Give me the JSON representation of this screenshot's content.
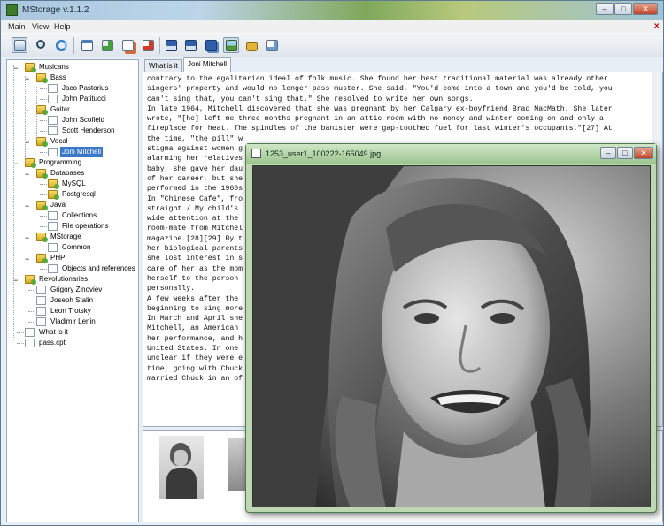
{
  "window": {
    "title": "MStorage v.1.1.2",
    "min": "–",
    "max": "□",
    "close": "✕"
  },
  "menu": {
    "items": [
      "Main",
      "View",
      "Help"
    ],
    "close": "x"
  },
  "toolbar": {
    "icons": [
      "tree-view-icon",
      "search-icon",
      "refresh-icon",
      "window-icon",
      "add-node-icon",
      "copy-icon",
      "delete-icon",
      "save-icon",
      "save-as-icon",
      "save-all-icon",
      "image-icon",
      "lock-icon",
      "find-icon"
    ]
  },
  "tree": [
    {
      "label": "Musicans",
      "level": 0,
      "kind": "folder",
      "exp": "−"
    },
    {
      "label": "Bass",
      "level": 1,
      "kind": "folder",
      "exp": "−"
    },
    {
      "label": "Jaco Pastorius",
      "level": 2,
      "kind": "doc"
    },
    {
      "label": "John Patitucci",
      "level": 2,
      "kind": "doc"
    },
    {
      "label": "Guitar",
      "level": 1,
      "kind": "folder",
      "exp": "−"
    },
    {
      "label": "John Scofield",
      "level": 2,
      "kind": "doc"
    },
    {
      "label": "Scott Henderson",
      "level": 2,
      "kind": "doc"
    },
    {
      "label": "Vocal",
      "level": 1,
      "kind": "folder",
      "exp": "−"
    },
    {
      "label": "Joni Mitchell",
      "level": 2,
      "kind": "doc",
      "selected": true
    },
    {
      "label": "Programming",
      "level": 0,
      "kind": "folder",
      "exp": "−"
    },
    {
      "label": "Databases",
      "level": 1,
      "kind": "folder",
      "exp": "−"
    },
    {
      "label": "MySQL",
      "level": 2,
      "kind": "folder"
    },
    {
      "label": "Postgresql",
      "level": 2,
      "kind": "folder"
    },
    {
      "label": "Java",
      "level": 1,
      "kind": "folder",
      "exp": "−"
    },
    {
      "label": "Collections",
      "level": 2,
      "kind": "doc"
    },
    {
      "label": "File operations",
      "level": 2,
      "kind": "doc"
    },
    {
      "label": "MStorage",
      "level": 1,
      "kind": "folder",
      "exp": "−"
    },
    {
      "label": "Common",
      "level": 2,
      "kind": "doc"
    },
    {
      "label": "PHP",
      "level": 1,
      "kind": "folder",
      "exp": "−"
    },
    {
      "label": "Objects and references",
      "level": 2,
      "kind": "doc"
    },
    {
      "label": "Revolutionaries",
      "level": 0,
      "kind": "folder",
      "exp": "−"
    },
    {
      "label": "Grigory Zinoviev",
      "level": 1,
      "kind": "doc"
    },
    {
      "label": "Joseph Stalin",
      "level": 1,
      "kind": "doc"
    },
    {
      "label": "Leon Trotsky",
      "level": 1,
      "kind": "doc"
    },
    {
      "label": "Vladimir Lenin",
      "level": 1,
      "kind": "doc"
    },
    {
      "label": "What is it",
      "level": 0,
      "kind": "doc"
    },
    {
      "label": "pass.cpt",
      "level": 0,
      "kind": "doc"
    }
  ],
  "tabs": [
    {
      "label": "What is it",
      "active": false
    },
    {
      "label": "Joni Mitchell",
      "active": true
    }
  ],
  "editor": {
    "lines": [
      "contrary to the egalitarian ideal of folk music. She found her best traditional material was already other",
      "singers' property and would no longer pass muster. She said, \"You'd come into a town and you'd be told, you",
      "can't sing that, you can't sing that.\" She resolved to write her own songs.",
      "In late 1964, Mitchell discovered that she was pregnant by her Calgary ex-boyfriend Brad MacMath. She later",
      "wrote, \"[he] left me three months pregnant in an attic room with no money and winter coming on and only a",
      "fireplace for heat. The spindles of the banister were gap-toothed fuel for last winter's occupants.\"[27] At",
      "the time, \"the pill\" w",
      "stigma against women g",
      "alarming her relatives",
      "baby, she gave her dau",
      "of her career, but she",
      "performed in the 1960s",
      "In \"Chinese Cafe\", fro",
      "straight / My child's",
      "wide attention at the",
      "room-mate from Mitchel",
      "magazine.[28][29] By t",
      "her biological parents",
      "she lost interest in s",
      "care of her as the mom",
      "herself to the person",
      "personally.",
      "A few weeks after the",
      "beginning to sing more",
      "In March and April she",
      "Mitchell, an American",
      "her performance, and h",
      "United States. In one",
      "unclear if they were e",
      "time, going with Chuck",
      "married Chuck in an of"
    ]
  },
  "imageViewer": {
    "title": "1253_user1_100222-165049.jpg",
    "min": "–",
    "max": "□",
    "close": "✕"
  }
}
